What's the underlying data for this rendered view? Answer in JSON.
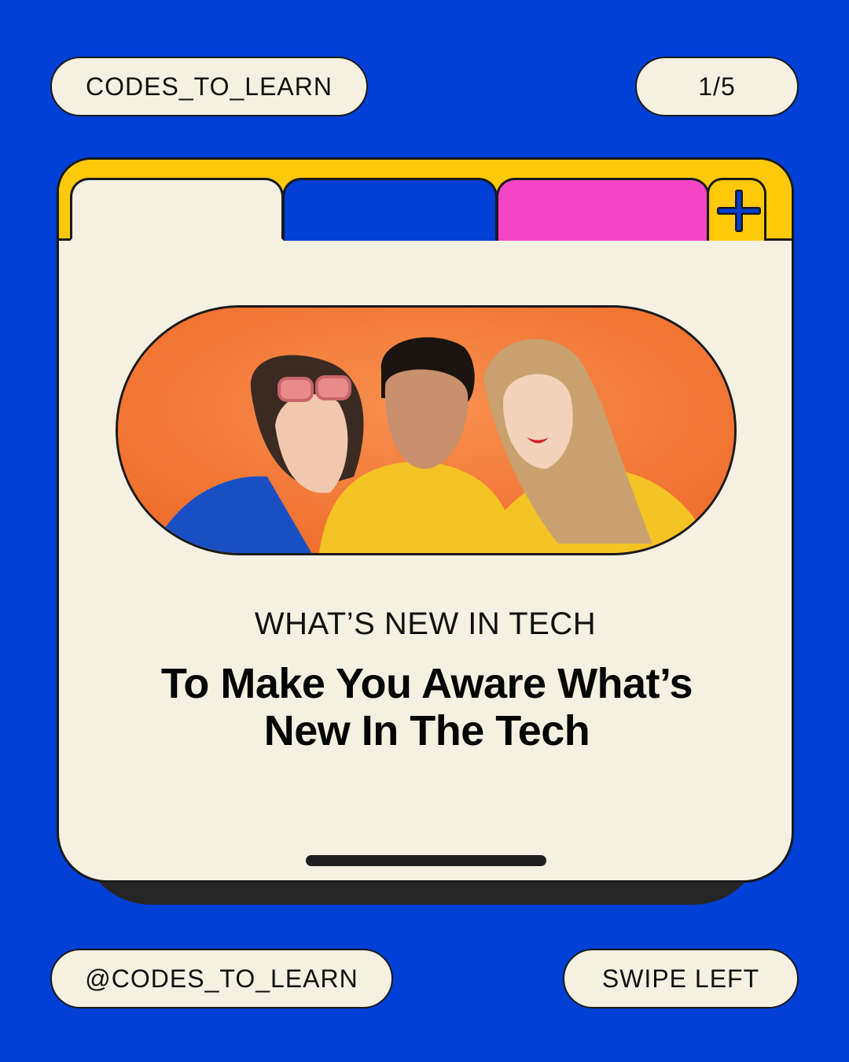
{
  "header": {
    "brand": "CODES_TO_LEARN",
    "page_indicator": "1/5"
  },
  "card": {
    "tabs": [
      {
        "color": "#f4f0e2"
      },
      {
        "color": "#0040d6"
      },
      {
        "color": "#f545c7"
      }
    ],
    "add_tab_icon": "plus-icon",
    "photo_alt": "photo-three-people-orange-background",
    "kicker": "WHAT’S NEW IN TECH",
    "headline_line1": "To Make You Aware What’s",
    "headline_line2": "New In The Tech"
  },
  "footer": {
    "handle": "@CODES_TO_LEARN",
    "swipe": "SWIPE LEFT"
  },
  "colors": {
    "background": "#0040d6",
    "cream": "#f4f0e2",
    "yellow": "#ffc90b",
    "pink": "#f545c7",
    "orange": "#f47b38"
  }
}
